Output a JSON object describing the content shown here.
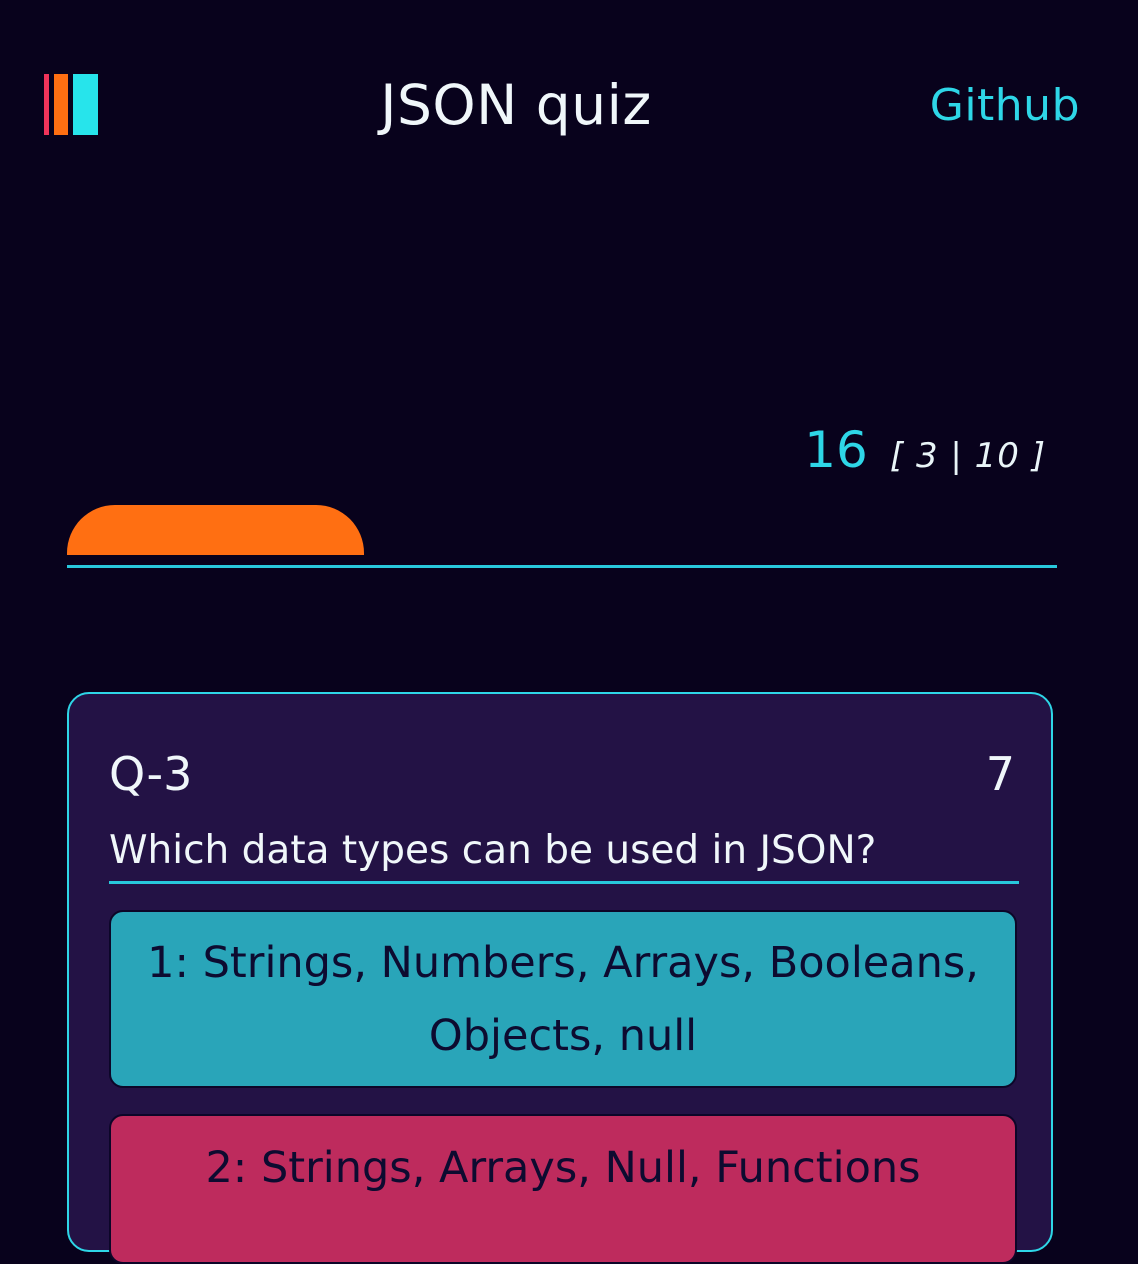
{
  "header": {
    "title": "JSON quiz",
    "github_label": "Github"
  },
  "progress": {
    "score": "16",
    "counter": "[ 3 | 10 ]",
    "fraction": 0.3
  },
  "question": {
    "number": "Q-3",
    "timer": "7",
    "text": "Which data types can be used in JSON?",
    "answers": [
      {
        "label": "1: Strings, Numbers, Arrays, Booleans, Objects, null"
      },
      {
        "label": "2: Strings, Arrays, Null, Functions"
      }
    ]
  },
  "colors": {
    "background": "#08021c",
    "accent": "#2ed6e7",
    "progress": "#ff6f12",
    "card": "#231245",
    "answer_teal": "#29a5b9",
    "answer_pink": "#be2b5d"
  },
  "icons": {
    "logo": "tricolor-bars-logo"
  }
}
